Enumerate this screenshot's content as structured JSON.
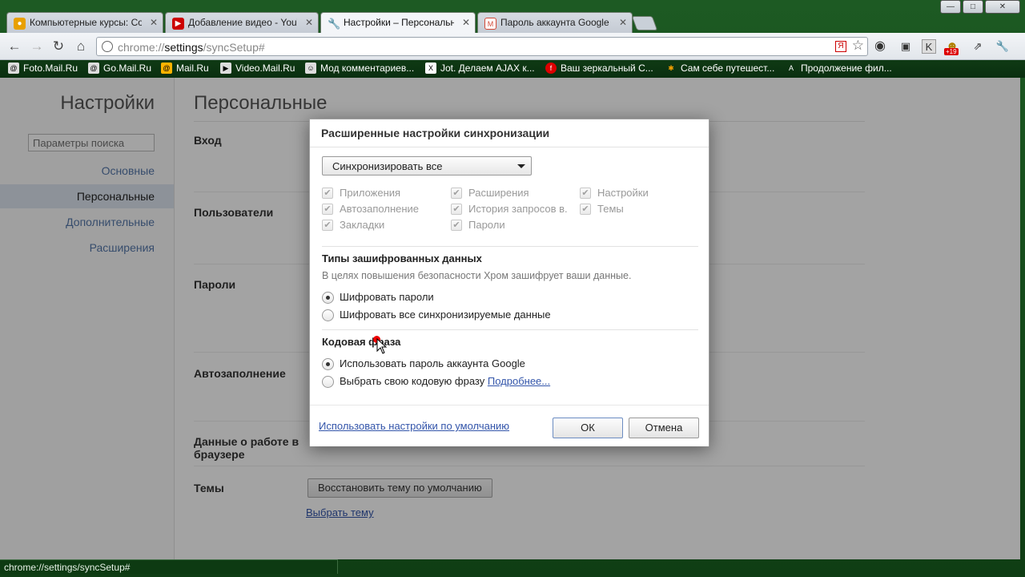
{
  "tabs": [
    {
      "label": "Компьютерные курсы: Co",
      "icon": "chrome-icon",
      "color": "#e8a000"
    },
    {
      "label": "Добавление видео - YouTu",
      "icon": "youtube-icon",
      "color": "#cc0000"
    },
    {
      "label": "Настройки – Персональнь",
      "icon": "wrench-icon",
      "color": "#666666"
    },
    {
      "label": "Пароль аккаунта Google б",
      "icon": "gmail-icon",
      "color": "#d14836"
    }
  ],
  "toolbar": {
    "url_scheme": "chrome://",
    "url_host": "settings",
    "url_path": "/syncSetup#"
  },
  "bookmarks": [
    {
      "label": "Foto.Mail.Ru",
      "icon": "mail-icon"
    },
    {
      "label": "Go.Mail.Ru",
      "icon": "mail-icon"
    },
    {
      "label": "Mail.Ru",
      "icon": "mail-icon"
    },
    {
      "label": "Video.Mail.Ru",
      "icon": "video-icon"
    },
    {
      "label": "Мод комментариев...",
      "icon": "page-icon"
    },
    {
      "label": "Jot. Делаем AJAX к...",
      "icon": "x-icon"
    },
    {
      "label": "Ваш зеркальный С...",
      "icon": "flash-icon"
    },
    {
      "label": "Сам себе путешест...",
      "icon": "joomla-icon"
    },
    {
      "label": "Продолжение фил...",
      "icon": "a-icon"
    }
  ],
  "extensions": {
    "badge": "+19"
  },
  "sidebar": {
    "title": "Настройки",
    "search_placeholder": "Параметры поиска",
    "items": [
      "Основные",
      "Персональные",
      "Дополнительные",
      "Расширения"
    ]
  },
  "main": {
    "title": "Персональные",
    "sections": [
      "Вход",
      "Пользователи",
      "Пароли",
      "Автозаполнение",
      "Данные о работе в браузере",
      "Темы"
    ],
    "theme_reset_button": "Восстановить тему по умолчанию",
    "theme_pick_link": "Выбрать тему"
  },
  "dialog": {
    "title": "Расширенные настройки синхронизации",
    "select_value": "Синхронизировать все",
    "checkboxes": [
      "Приложения",
      "Расширения",
      "Настройки",
      "Автозаполнение",
      "История запросов в.",
      "Темы",
      "Закладки",
      "Пароли"
    ],
    "encryption_heading": "Типы зашифрованных данных",
    "encryption_desc": "В целях повышения безопасности Хром зашифрует ваши данные.",
    "encrypt_options": [
      "Шифровать пароли",
      "Шифровать все синхронизируемые данные"
    ],
    "encrypt_selected": 0,
    "passphrase_heading": "Кодовая фраза",
    "passphrase_options": [
      "Использовать пароль аккаунта Google",
      "Выбрать свою кодовую фразу"
    ],
    "passphrase_more": "Подробнее...",
    "passphrase_selected": 0,
    "default_link": "Использовать настройки по умолчанию",
    "ok_label": "ОК",
    "cancel_label": "Отмена"
  },
  "status_text": "chrome://settings/syncSetup#"
}
